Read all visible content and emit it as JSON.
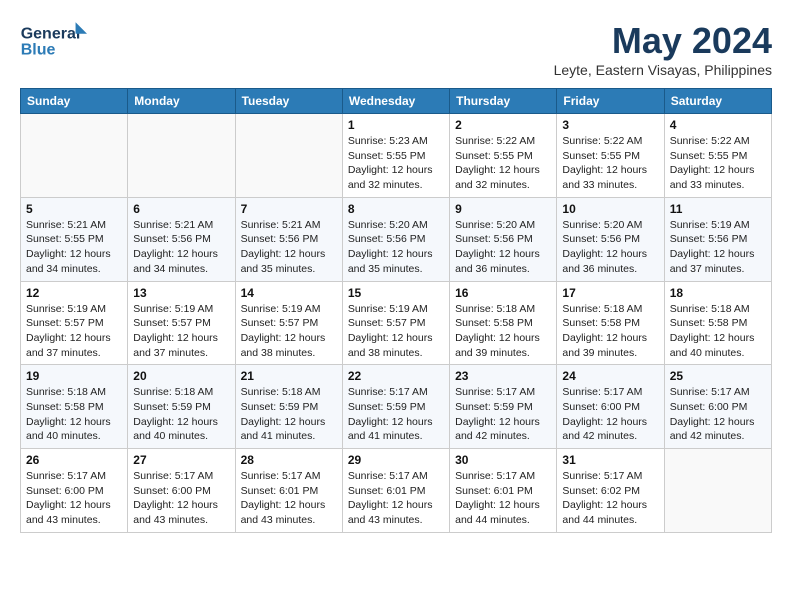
{
  "logo": {
    "line1": "General",
    "line2": "Blue"
  },
  "title": "May 2024",
  "subtitle": "Leyte, Eastern Visayas, Philippines",
  "weekdays": [
    "Sunday",
    "Monday",
    "Tuesday",
    "Wednesday",
    "Thursday",
    "Friday",
    "Saturday"
  ],
  "weeks": [
    [
      {
        "day": "",
        "info": ""
      },
      {
        "day": "",
        "info": ""
      },
      {
        "day": "",
        "info": ""
      },
      {
        "day": "1",
        "info": "Sunrise: 5:23 AM\nSunset: 5:55 PM\nDaylight: 12 hours\nand 32 minutes."
      },
      {
        "day": "2",
        "info": "Sunrise: 5:22 AM\nSunset: 5:55 PM\nDaylight: 12 hours\nand 32 minutes."
      },
      {
        "day": "3",
        "info": "Sunrise: 5:22 AM\nSunset: 5:55 PM\nDaylight: 12 hours\nand 33 minutes."
      },
      {
        "day": "4",
        "info": "Sunrise: 5:22 AM\nSunset: 5:55 PM\nDaylight: 12 hours\nand 33 minutes."
      }
    ],
    [
      {
        "day": "5",
        "info": "Sunrise: 5:21 AM\nSunset: 5:55 PM\nDaylight: 12 hours\nand 34 minutes."
      },
      {
        "day": "6",
        "info": "Sunrise: 5:21 AM\nSunset: 5:56 PM\nDaylight: 12 hours\nand 34 minutes."
      },
      {
        "day": "7",
        "info": "Sunrise: 5:21 AM\nSunset: 5:56 PM\nDaylight: 12 hours\nand 35 minutes."
      },
      {
        "day": "8",
        "info": "Sunrise: 5:20 AM\nSunset: 5:56 PM\nDaylight: 12 hours\nand 35 minutes."
      },
      {
        "day": "9",
        "info": "Sunrise: 5:20 AM\nSunset: 5:56 PM\nDaylight: 12 hours\nand 36 minutes."
      },
      {
        "day": "10",
        "info": "Sunrise: 5:20 AM\nSunset: 5:56 PM\nDaylight: 12 hours\nand 36 minutes."
      },
      {
        "day": "11",
        "info": "Sunrise: 5:19 AM\nSunset: 5:56 PM\nDaylight: 12 hours\nand 37 minutes."
      }
    ],
    [
      {
        "day": "12",
        "info": "Sunrise: 5:19 AM\nSunset: 5:57 PM\nDaylight: 12 hours\nand 37 minutes."
      },
      {
        "day": "13",
        "info": "Sunrise: 5:19 AM\nSunset: 5:57 PM\nDaylight: 12 hours\nand 37 minutes."
      },
      {
        "day": "14",
        "info": "Sunrise: 5:19 AM\nSunset: 5:57 PM\nDaylight: 12 hours\nand 38 minutes."
      },
      {
        "day": "15",
        "info": "Sunrise: 5:19 AM\nSunset: 5:57 PM\nDaylight: 12 hours\nand 38 minutes."
      },
      {
        "day": "16",
        "info": "Sunrise: 5:18 AM\nSunset: 5:58 PM\nDaylight: 12 hours\nand 39 minutes."
      },
      {
        "day": "17",
        "info": "Sunrise: 5:18 AM\nSunset: 5:58 PM\nDaylight: 12 hours\nand 39 minutes."
      },
      {
        "day": "18",
        "info": "Sunrise: 5:18 AM\nSunset: 5:58 PM\nDaylight: 12 hours\nand 40 minutes."
      }
    ],
    [
      {
        "day": "19",
        "info": "Sunrise: 5:18 AM\nSunset: 5:58 PM\nDaylight: 12 hours\nand 40 minutes."
      },
      {
        "day": "20",
        "info": "Sunrise: 5:18 AM\nSunset: 5:59 PM\nDaylight: 12 hours\nand 40 minutes."
      },
      {
        "day": "21",
        "info": "Sunrise: 5:18 AM\nSunset: 5:59 PM\nDaylight: 12 hours\nand 41 minutes."
      },
      {
        "day": "22",
        "info": "Sunrise: 5:17 AM\nSunset: 5:59 PM\nDaylight: 12 hours\nand 41 minutes."
      },
      {
        "day": "23",
        "info": "Sunrise: 5:17 AM\nSunset: 5:59 PM\nDaylight: 12 hours\nand 42 minutes."
      },
      {
        "day": "24",
        "info": "Sunrise: 5:17 AM\nSunset: 6:00 PM\nDaylight: 12 hours\nand 42 minutes."
      },
      {
        "day": "25",
        "info": "Sunrise: 5:17 AM\nSunset: 6:00 PM\nDaylight: 12 hours\nand 42 minutes."
      }
    ],
    [
      {
        "day": "26",
        "info": "Sunrise: 5:17 AM\nSunset: 6:00 PM\nDaylight: 12 hours\nand 43 minutes."
      },
      {
        "day": "27",
        "info": "Sunrise: 5:17 AM\nSunset: 6:00 PM\nDaylight: 12 hours\nand 43 minutes."
      },
      {
        "day": "28",
        "info": "Sunrise: 5:17 AM\nSunset: 6:01 PM\nDaylight: 12 hours\nand 43 minutes."
      },
      {
        "day": "29",
        "info": "Sunrise: 5:17 AM\nSunset: 6:01 PM\nDaylight: 12 hours\nand 43 minutes."
      },
      {
        "day": "30",
        "info": "Sunrise: 5:17 AM\nSunset: 6:01 PM\nDaylight: 12 hours\nand 44 minutes."
      },
      {
        "day": "31",
        "info": "Sunrise: 5:17 AM\nSunset: 6:02 PM\nDaylight: 12 hours\nand 44 minutes."
      },
      {
        "day": "",
        "info": ""
      }
    ]
  ]
}
